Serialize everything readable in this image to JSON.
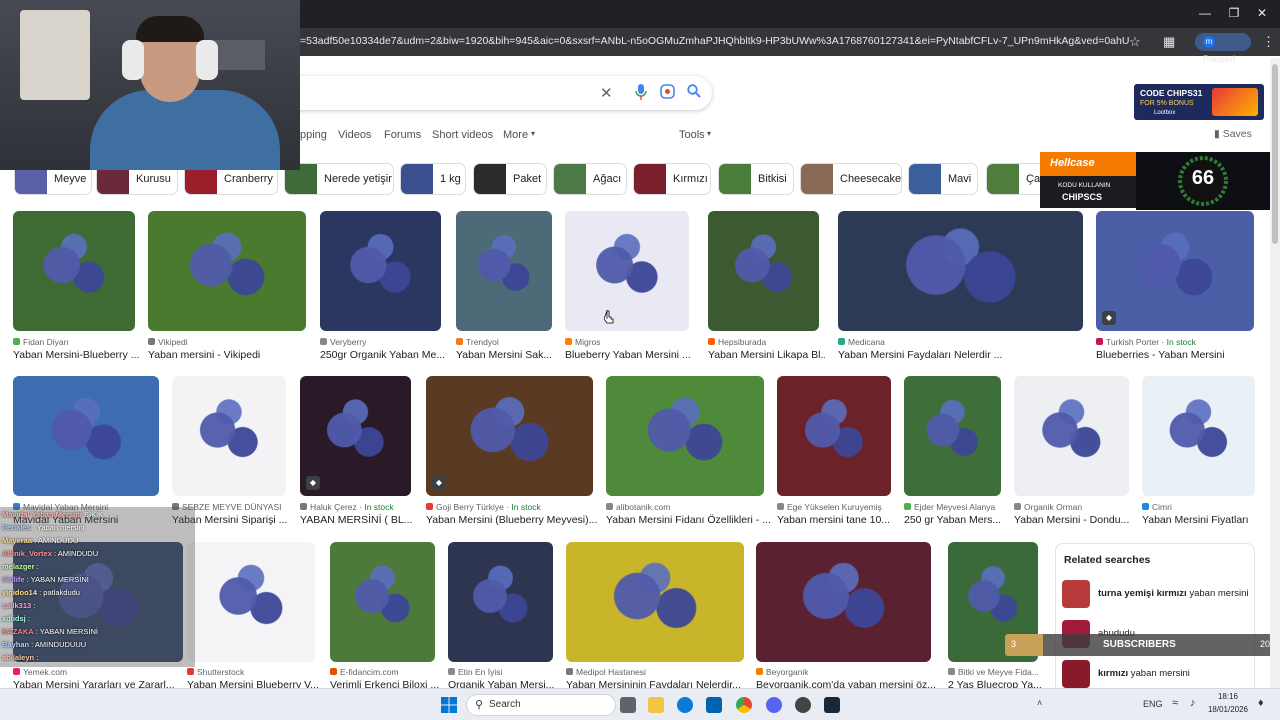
{
  "browser": {
    "url": "=53adf50e10334de7&udm=2&biw=1920&bih=945&aic=0&sxsrf=ANbL-n5oOGMuZmhaPJHQhbltk9-HP3bUWw%3A1768760127341&ei=PyNtabfCFLv-7_UPn9mHkAg&ved=0ahUKEwj33dT42JWSAx...",
    "profile_initial": "m",
    "profile_status": "Paused"
  },
  "search": {
    "tabs": [
      "pping",
      "Videos",
      "Forums",
      "Short videos",
      "More",
      "Tools"
    ],
    "saves_label": "Saves"
  },
  "chips": [
    {
      "label": "Meyve",
      "color": "#5a5fa8"
    },
    {
      "label": "Kurusu",
      "color": "#6b2a3a"
    },
    {
      "label": "Cranberry",
      "color": "#9b1e2b"
    },
    {
      "label": "Nerede yetişir",
      "color": "#3d6b3a"
    },
    {
      "label": "1 kg",
      "color": "#3c4f8e"
    },
    {
      "label": "Paket",
      "color": "#2b2b2b"
    },
    {
      "label": "Ağacı",
      "color": "#4c7a46"
    },
    {
      "label": "Kırmızı",
      "color": "#7a1f2c"
    },
    {
      "label": "Bitkisi",
      "color": "#4a7d3a"
    },
    {
      "label": "Cheesecake",
      "color": "#8a6a55"
    },
    {
      "label": "Mavi",
      "color": "#3a5f9a"
    },
    {
      "label": "Çal",
      "color": "#4f7d3b"
    }
  ],
  "rows": [
    [
      {
        "source": "Fidan Diyarı",
        "title": "Yaban Mersini-Blueberry ...",
        "stock": "",
        "color": "#3e6b34",
        "fav": "#4caf50"
      },
      {
        "source": "Vikipedi",
        "title": "Yaban mersini - Vikipedi",
        "stock": "",
        "color": "#4a7a2e",
        "fav": "#777"
      },
      {
        "source": "Veryberry",
        "title": "250gr Organik Yaban Me...",
        "stock": "",
        "color": "#2b3760",
        "fav": "#888"
      },
      {
        "source": "Trendyol",
        "title": "Yaban Mersini Sak...",
        "stock": "",
        "color": "#4d6a78",
        "fav": "#f27a1a"
      },
      {
        "source": "Migros",
        "title": "Blueberry Yaban Mersini ...",
        "stock": "",
        "color": "#e8e9f2",
        "fav": "#ff7f00"
      },
      {
        "source": "Hepsiburada",
        "title": "Yaban Mersini Likapa Bl...",
        "stock": "",
        "color": "#3b5a32",
        "fav": "#ff6000"
      },
      {
        "source": "Medicana",
        "title": "Yaban Mersini Faydaları Nelerdir ...",
        "stock": "",
        "color": "#2c3a55",
        "fav": "#2ca58d"
      },
      {
        "source": "Turkish Porter",
        "title": "Blueberries - Yaban Mersini",
        "stock": "In stock",
        "color": "#4a5fa6",
        "fav": "#c2185b"
      }
    ],
    [
      {
        "source": "Mavidal Yaban Mersini",
        "title": "Mavidal Yaban Mersini",
        "stock": "",
        "color": "#3d6cb0",
        "fav": "#3b7bd1"
      },
      {
        "source": "SEBZE MEYVE DÜNYASI",
        "title": "Yaban Mersini Siparişi ...",
        "stock": "",
        "color": "#f3f3f5",
        "fav": "#777"
      },
      {
        "source": "Haluk Çerez",
        "title": "YABAN MERSİNİ ( BL...",
        "stock": "In stock",
        "color": "#2a1a28",
        "fav": "#777"
      },
      {
        "source": "Goji Berry Türkiye",
        "title": "Yaban Mersini (Blueberry Meyvesi)...",
        "stock": "In stock",
        "color": "#5a3a22",
        "fav": "#e53935"
      },
      {
        "source": "alibotanik.com",
        "title": "Yaban Mersini Fidanı Özellikleri - ...",
        "stock": "",
        "color": "#4e8a3a",
        "fav": "#888"
      },
      {
        "source": "Ege Yükselen Kuruyemiş",
        "title": "Yaban mersini tane 10...",
        "stock": "",
        "color": "#6b2228",
        "fav": "#888"
      },
      {
        "source": "Ejder Meyvesi Alanya",
        "title": "250 gr Yaban Mers...",
        "stock": "",
        "color": "#3e6f3a",
        "fav": "#4caf50"
      },
      {
        "source": "Organik Orman",
        "title": "Yaban Mersini - Dondu...",
        "stock": "",
        "color": "#eeeff2",
        "fav": "#888"
      },
      {
        "source": "Cimri",
        "title": "Yaban Mersini Fiyatları",
        "stock": "",
        "color": "#e9f1f7",
        "fav": "#1e88e5"
      }
    ],
    [
      {
        "source": "Yemek.com",
        "title": "Yaban Mersini Yararları ve Zararl...",
        "stock": "",
        "color": "#3a4a70",
        "fav": "#e91e63"
      },
      {
        "source": "Shutterstock",
        "title": "Yaban Mersini Blueberry V...",
        "stock": "",
        "color": "#f4f4f6",
        "fav": "#e53935"
      },
      {
        "source": "E-fidancim.com",
        "title": "Verimli Erkenci Biloxi ...",
        "stock": "",
        "color": "#4d7a3a",
        "fav": "#e65100"
      },
      {
        "source": "Etin En İyisi",
        "title": "Organik Yaban Mersi...",
        "stock": "",
        "color": "#2d3550",
        "fav": "#888"
      },
      {
        "source": "Medipol Hastanesi",
        "title": "Yaban Mersininin Faydaları Nelerdir...",
        "stock": "",
        "color": "#c9b52a",
        "fav": "#777"
      },
      {
        "source": "Beyorganik",
        "title": "Beyorganik.com'da yaban mersini öz...",
        "stock": "",
        "color": "#5a2230",
        "fav": "#f57c00"
      },
      {
        "source": "Bitki ve Meyve Fida...",
        "title": "2 Yaş Bluecrop Ya...",
        "stock": "",
        "color": "#3b6a3a",
        "fav": "#888"
      }
    ]
  ],
  "related": {
    "heading": "Related searches",
    "items": [
      {
        "bold": "turna yemişi kırmızı",
        "rest": " yaban mersini",
        "color": "#b83a3a"
      },
      {
        "bold": "",
        "rest": "ahududu",
        "color": "#a21a3a"
      },
      {
        "bold": "kırmızı",
        "rest": " yaban mersini",
        "color": "#8a1a2a"
      }
    ]
  },
  "overlays": {
    "ad_code": "CODE CHIPS31",
    "ad_bonus": "FOR 5% BONUS",
    "ad_brand": "Lootbox",
    "hellcase_brand": "Hellcase",
    "hellcase_line1": "KODU KULLANIN",
    "hellcase_line2": "CHIPSCS",
    "timer_value": "66",
    "subs_label": "SUBSCRIBERS",
    "subs_left": "3",
    "subs_right": "20"
  },
  "chat": [
    {
      "user": "Mavidal Yaban Mersini",
      "msg": " SIKIK",
      "color": "#ffb3b3"
    },
    {
      "user": "Perikles",
      "msg": " : Yaban mersini",
      "color": "#9fd3ff"
    },
    {
      "user": "Mayeraa",
      "msg": " : AMINDUDU",
      "color": "#ffd27f"
    },
    {
      "user": "Altinik_Vortex",
      "msg": " : AMINDUDU",
      "color": "#ff8f8f"
    },
    {
      "user": "melazger",
      "msg": " :",
      "color": "#b9ff9f"
    },
    {
      "user": "Sidlife",
      "msg": " : YABAN MERSİNİ",
      "color": "#c0a0ff"
    },
    {
      "user": "yigidoo14",
      "msg": " : patlakdudu",
      "color": "#ffe08a"
    },
    {
      "user": "sallk313",
      "msg": " :",
      "color": "#ff9fd6"
    },
    {
      "user": "xdlidsj",
      "msg": " :",
      "color": "#9fffe0"
    },
    {
      "user": "KAZAKA",
      "msg": " : YABAN MERSİNİ",
      "color": "#ff7f7f"
    },
    {
      "user": "Bayhan",
      "msg": " : AMINDUDUUU",
      "color": "#b0d0ff"
    },
    {
      "user": "abilaleyn",
      "msg": " :",
      "color": "#ffc39f"
    }
  ],
  "taskbar": {
    "search_label": "Search",
    "lang": "ENG",
    "time": "18:16",
    "date": "18/01/2026"
  }
}
